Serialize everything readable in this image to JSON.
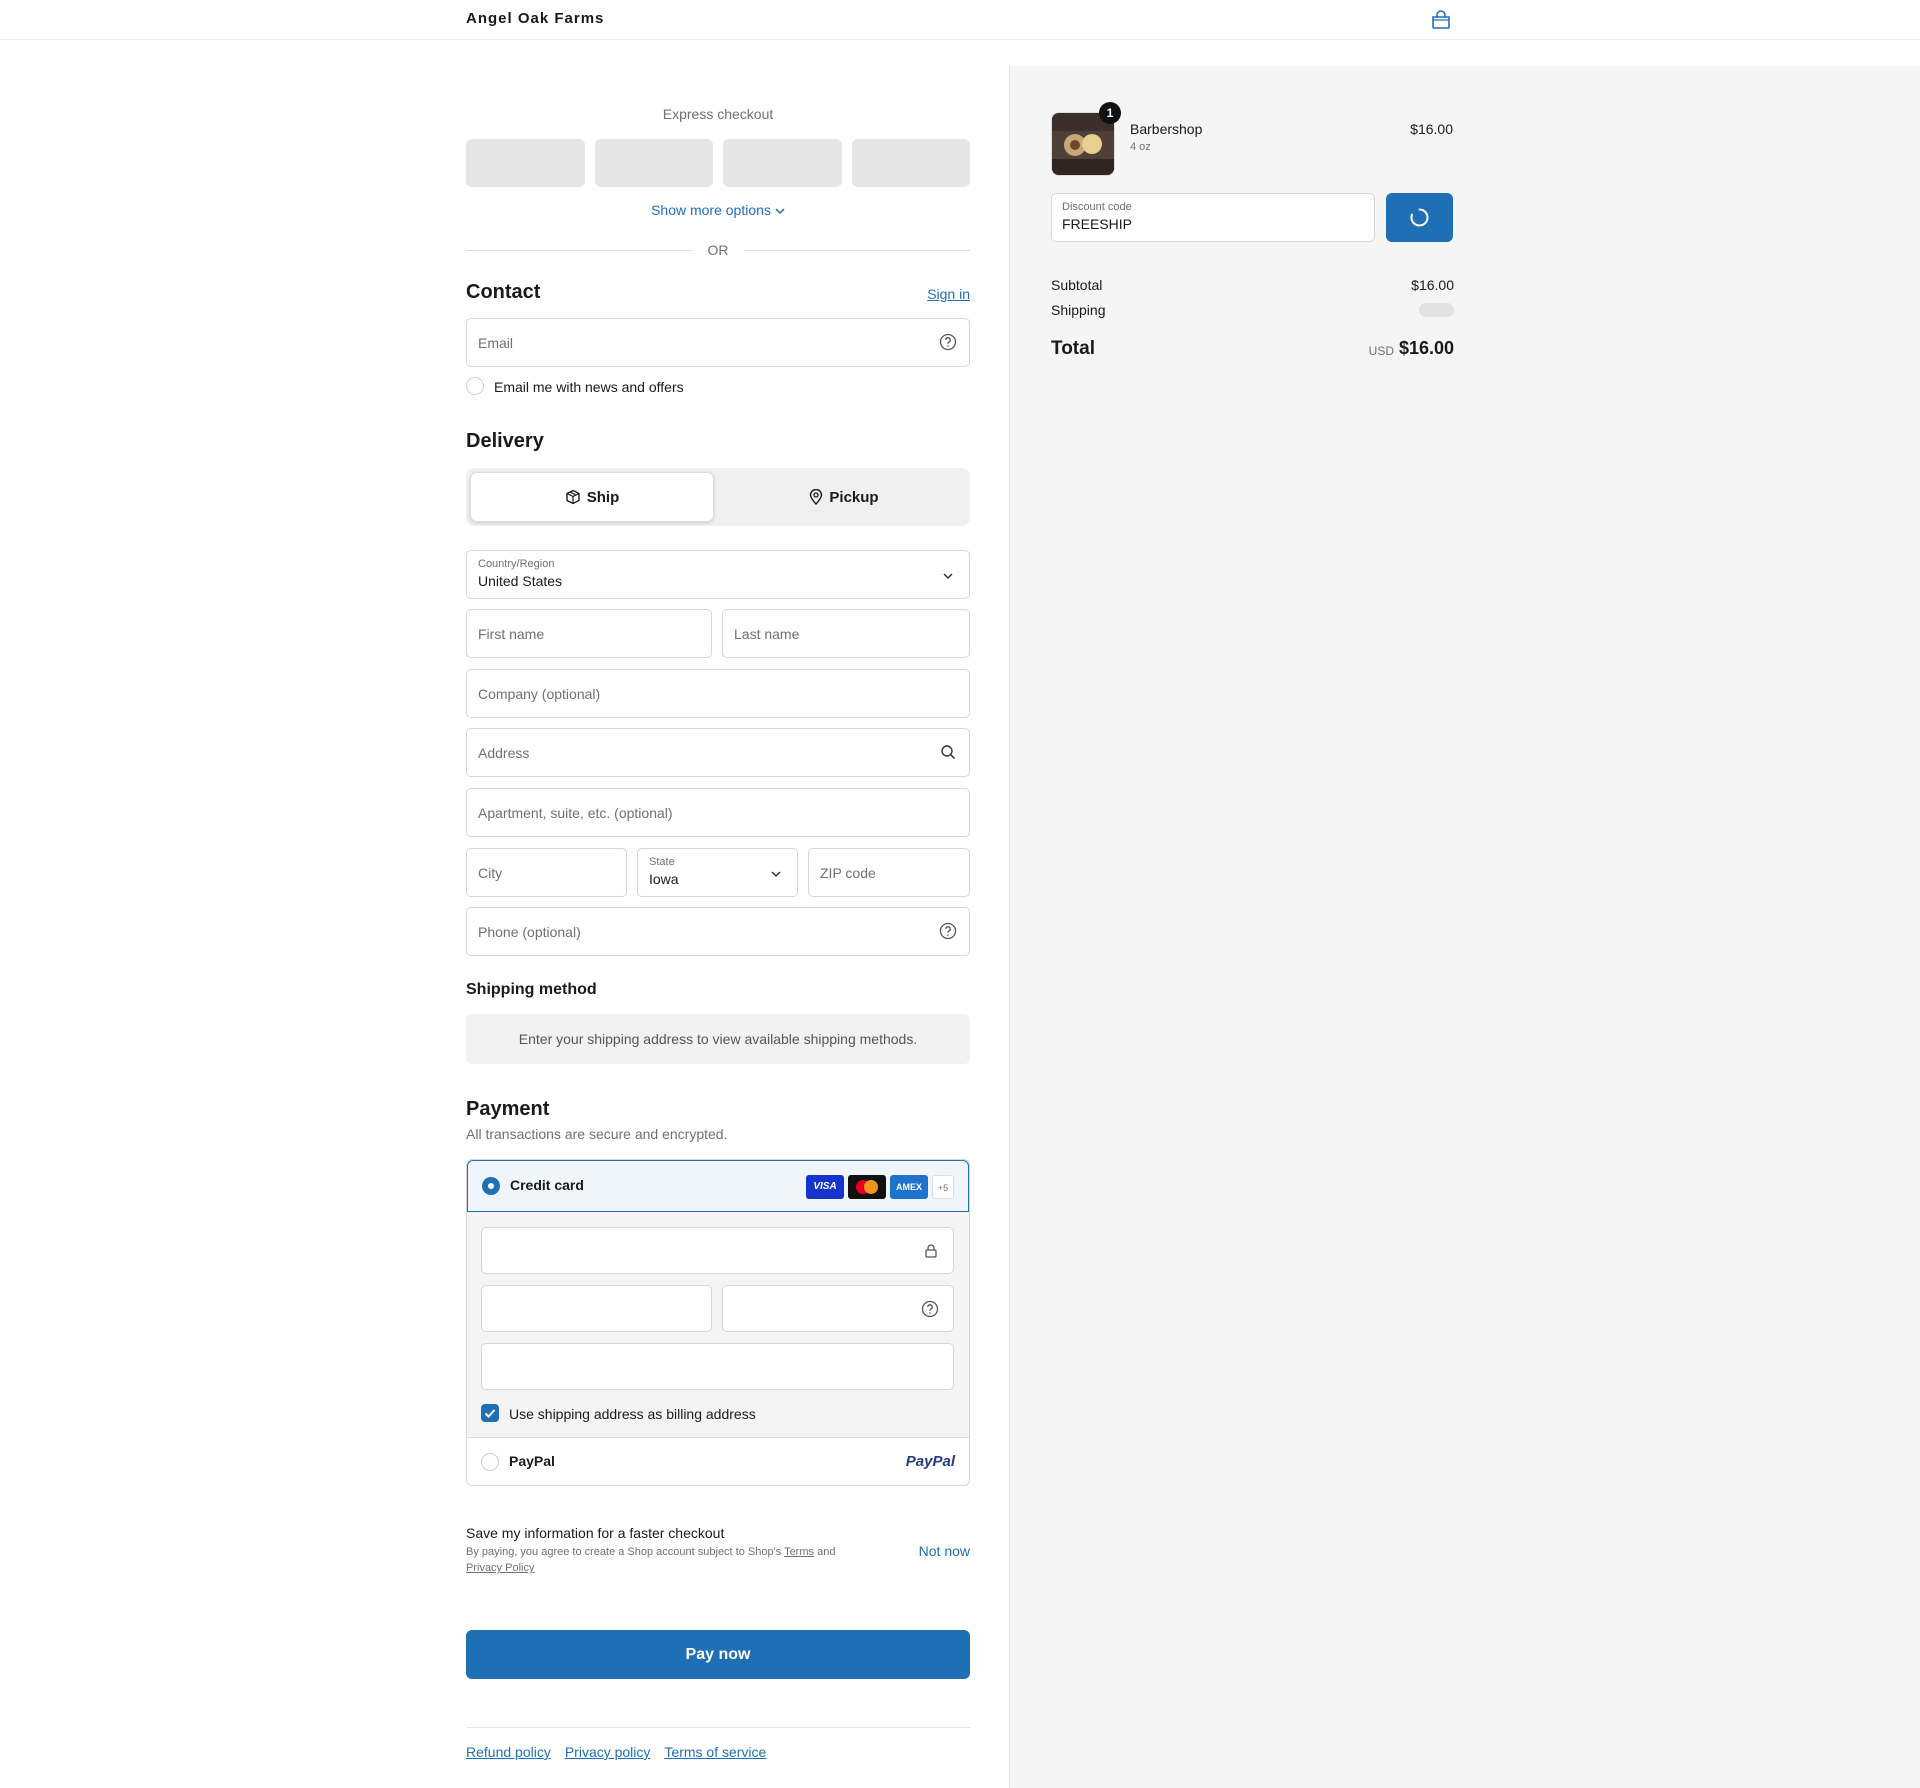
{
  "header": {
    "brand": "Angel Oak Farms",
    "cart_icon": "shopping-bag-icon"
  },
  "express": {
    "title": "Express checkout",
    "show_more": "Show more options",
    "or": "OR"
  },
  "contact": {
    "title": "Contact",
    "sign_in": "Sign in",
    "email_placeholder": "Email",
    "news_label": "Email me with news and offers",
    "news_checked": false
  },
  "delivery": {
    "title": "Delivery",
    "ship_label": "Ship",
    "pickup_label": "Pickup",
    "selected": "Ship",
    "country_label": "Country/Region",
    "country_value": "United States",
    "first_name": "First name",
    "last_name": "Last name",
    "company": "Company (optional)",
    "address": "Address",
    "apartment": "Apartment, suite, etc. (optional)",
    "city": "City",
    "state_label": "State",
    "state_value": "Iowa",
    "zip": "ZIP code",
    "phone": "Phone (optional)"
  },
  "shipping_method": {
    "title": "Shipping method",
    "message": "Enter your shipping address to view available shipping methods."
  },
  "payment": {
    "title": "Payment",
    "subtitle": "All transactions are secure and encrypted.",
    "credit_card_label": "Credit card",
    "card_logos": [
      "VISA",
      "Mastercard",
      "AMEX",
      "+5"
    ],
    "billing_same_label": "Use shipping address as billing address",
    "billing_same_checked": true,
    "paypal_label": "PayPal",
    "paypal_logo": "PayPal"
  },
  "save_info": {
    "title": "Save my information for a faster checkout",
    "fine_print_1": "By paying, you agree to create a Shop account subject to Shop's",
    "terms_link": "Terms",
    "and": "and",
    "privacy_link": "Privacy Policy",
    "not_now": "Not now"
  },
  "pay_button": "Pay now",
  "footer": {
    "refund": "Refund policy",
    "privacy": "Privacy policy",
    "terms": "Terms of service"
  },
  "summary": {
    "item": {
      "name": "Barbershop",
      "variant": "4 oz",
      "price": "$16.00",
      "quantity": "1"
    },
    "discount_label": "Discount code",
    "discount_value": "FREESHIP",
    "subtotal_label": "Subtotal",
    "subtotal_value": "$16.00",
    "shipping_label": "Shipping",
    "total_label": "Total",
    "total_currency": "USD",
    "total_value": "$16.00"
  },
  "colors": {
    "accent": "#1f6fb5",
    "sidebar_bg": "#f5f5f5",
    "express_btn": "#e6e6e6"
  }
}
